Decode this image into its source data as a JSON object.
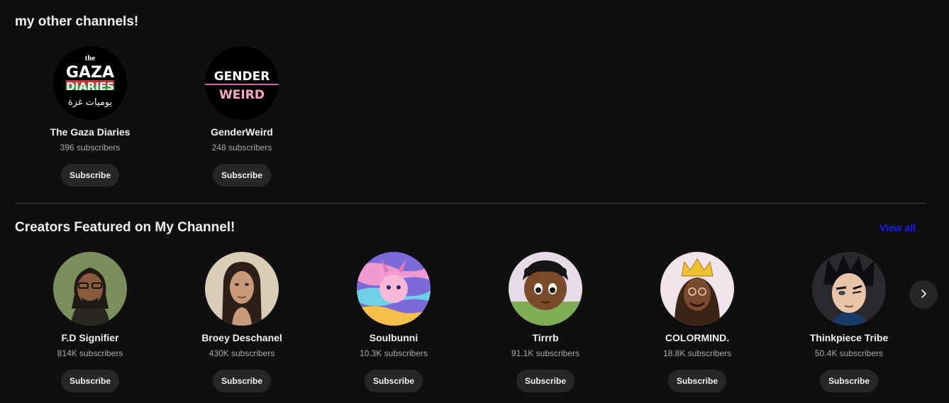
{
  "sections": {
    "other_channels": {
      "title": "my other channels!",
      "channels": [
        {
          "name": "The Gaza Diaries",
          "subscribers": "396 subscribers",
          "subscribe_label": "Subscribe",
          "logo": {
            "top": "the",
            "line1": "GAZA",
            "line2": "DIARIES",
            "arabic": "يوميات غزة"
          }
        },
        {
          "name": "GenderWeird",
          "subscribers": "248 subscribers",
          "subscribe_label": "Subscribe",
          "logo": {
            "line1": "GENDER",
            "line2": "WEIRD"
          }
        }
      ]
    },
    "featured": {
      "title": "Creators Featured on My Channel!",
      "view_all_label": "View all",
      "channels": [
        {
          "name": "F.D Signifier",
          "subscribers": "814K subscribers",
          "subscribe_label": "Subscribe"
        },
        {
          "name": "Broey Deschanel",
          "subscribers": "430K subscribers",
          "subscribe_label": "Subscribe"
        },
        {
          "name": "Soulbunni",
          "subscribers": "10.3K subscribers",
          "subscribe_label": "Subscribe"
        },
        {
          "name": "Tirrrb",
          "subscribers": "91.1K subscribers",
          "subscribe_label": "Subscribe"
        },
        {
          "name": "COLORMIND.",
          "subscribers": "18.8K subscribers",
          "subscribe_label": "Subscribe"
        },
        {
          "name": "Thinkpiece Tribe",
          "subscribers": "50.4K subscribers",
          "subscribe_label": "Subscribe"
        }
      ]
    }
  },
  "icons": {
    "next": "chevron-right-icon"
  },
  "colors": {
    "background": "#0f0f0f",
    "button_bg": "#272727",
    "link": "#1a1aff",
    "divider": "#3f3f3f"
  }
}
